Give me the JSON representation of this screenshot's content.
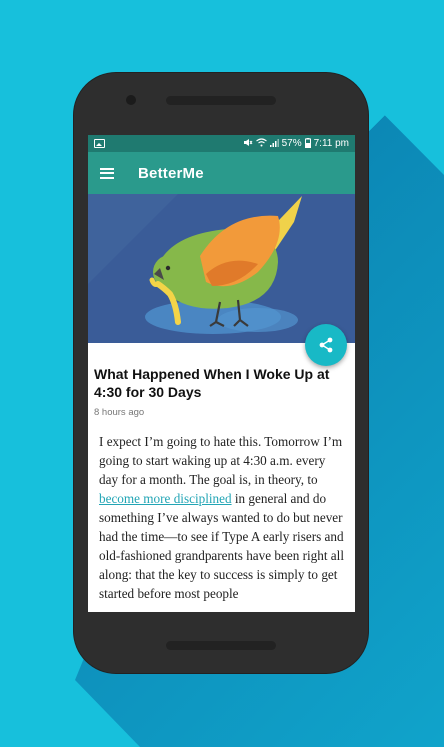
{
  "status_bar": {
    "battery_percent": "57%",
    "time": "7:11 pm",
    "icons": [
      "image-icon",
      "mute-icon",
      "wifi-icon",
      "signal-icon",
      "battery-icon"
    ]
  },
  "app_bar": {
    "title": "BetterMe",
    "menu_icon": "hamburger-menu-icon"
  },
  "hero": {
    "illustration": "green-bird-eating-worm",
    "share_icon": "share-icon"
  },
  "article": {
    "title": "What Happened When I Woke Up at 4:30 for 30 Days",
    "time": "8 hours ago",
    "body_before_link": "I expect I’m going to hate this. Tomorrow I’m going to start waking up at 4:30 a.m. every day for a month. The goal is, in theory, to ",
    "link_text": "become more disciplined",
    "body_after_link": " in general and do something I’ve always wanted to do but never had the time—to see if Type A early risers and old-fashioned grandparents have been right all along: that the key to success is simply to get started before most people"
  },
  "colors": {
    "background": "#17c0dc",
    "status_bar": "#1f7a70",
    "app_bar": "#2a9a8c",
    "hero_bg": "#3a5c98",
    "fab": "#18b9c6",
    "link": "#22a5b5"
  }
}
